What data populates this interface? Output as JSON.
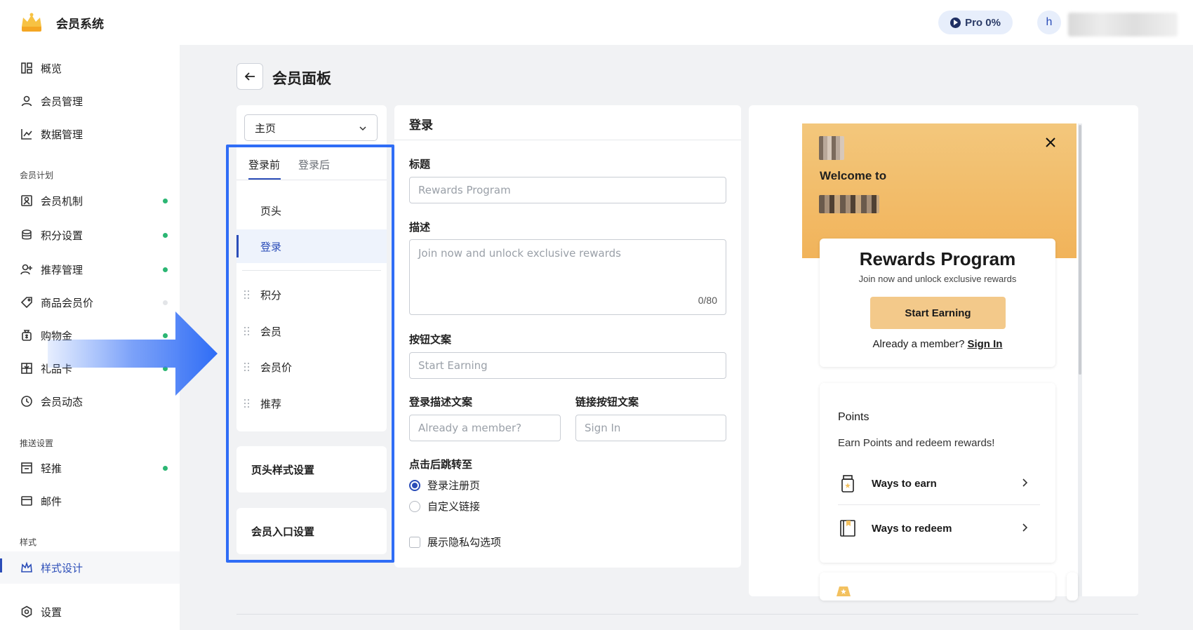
{
  "header": {
    "app_title": "会员系统",
    "pro_label": "Pro 0%",
    "avatar_initial": "h"
  },
  "sidebar": {
    "items": [
      {
        "label": "概览",
        "icon": "grid-icon"
      },
      {
        "label": "会员管理",
        "icon": "user-icon"
      },
      {
        "label": "数据管理",
        "icon": "chart-icon"
      },
      {
        "label": "会员机制",
        "icon": "member-card-icon",
        "status": "green"
      },
      {
        "label": "积分设置",
        "icon": "coins-icon",
        "status": "green"
      },
      {
        "label": "推荐管理",
        "icon": "user-plus-icon",
        "status": "green"
      },
      {
        "label": "商品会员价",
        "icon": "tag-icon",
        "status": "gray"
      },
      {
        "label": "购物金",
        "icon": "money-bag-icon",
        "status": "green"
      },
      {
        "label": "礼品卡",
        "icon": "gift-card-icon",
        "status": "green"
      },
      {
        "label": "会员动态",
        "icon": "clock-icon"
      },
      {
        "label": "轻推",
        "icon": "nudge-icon",
        "status": "green"
      },
      {
        "label": "邮件",
        "icon": "mail-icon"
      },
      {
        "label": "样式设计",
        "icon": "crown-icon"
      },
      {
        "label": "设置",
        "icon": "settings-icon"
      }
    ],
    "sections": {
      "plan": "会员计划",
      "push": "推送设置",
      "style": "样式"
    },
    "status_colors": {
      "green": "#2bb673",
      "gray": "#e3e5e8"
    }
  },
  "page": {
    "title": "会员面板"
  },
  "config": {
    "page_select": "主页",
    "tabs": [
      "登录前",
      "登录后"
    ],
    "sections": {
      "header": "页头",
      "login": "登录",
      "points": "积分",
      "member": "会员",
      "member_price": "会员价",
      "referral": "推荐"
    },
    "header_style": "页头样式设置",
    "entry_settings": "会员入口设置"
  },
  "form": {
    "title": "登录",
    "title_label": "标题",
    "title_placeholder": "Rewards Program",
    "desc_label": "描述",
    "desc_placeholder": "Join now and unlock exclusive rewards",
    "desc_counter": "0/80",
    "button_label": "按钮文案",
    "button_placeholder": "Start Earning",
    "login_desc_label": "登录描述文案",
    "login_desc_placeholder": "Already a member?",
    "link_label": "链接按钮文案",
    "link_placeholder": "Sign In",
    "redirect_label": "点击后跳转至",
    "redirect_options": [
      "登录注册页",
      "自定义链接"
    ],
    "redirect_selected": "登录注册页",
    "privacy_label": "展示隐私勾选项"
  },
  "preview": {
    "welcome": "Welcome to",
    "rp_title": "Rewards Program",
    "rp_subtitle": "Join now and unlock exclusive rewards",
    "rp_button": "Start Earning",
    "member_text": "Already a member?",
    "signin_text": "Sign In",
    "points_title": "Points",
    "points_subtitle": "Earn Points and redeem rewards!",
    "ways_to_earn": "Ways to earn",
    "ways_to_redeem": "Ways to redeem"
  },
  "colors": {
    "accent": "#2b4db8",
    "highlight": "#2f6df6",
    "hero": "#f1b35a",
    "cta": "#f3c98a"
  }
}
